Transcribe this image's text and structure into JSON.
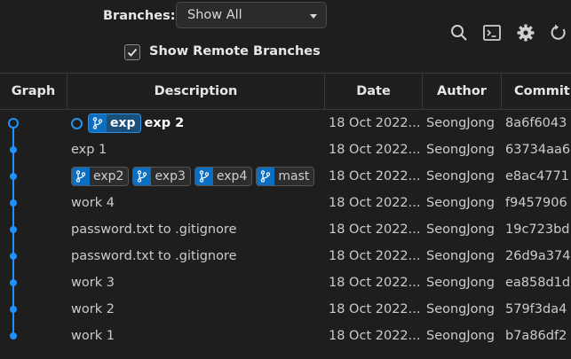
{
  "toolbar": {
    "branches_label": "Branches:",
    "branches_value": "Show All",
    "show_remote_label": "Show Remote Branches",
    "show_remote_checked": true,
    "icons": [
      "search-icon",
      "terminal-icon",
      "gear-icon",
      "refresh-icon"
    ]
  },
  "columns": {
    "graph": "Graph",
    "description": "Description",
    "date": "Date",
    "author": "Author",
    "commit": "Commit"
  },
  "colors": {
    "accent": "#0a6fc2",
    "graph": "#1e90ff"
  },
  "commits": [
    {
      "badges": [
        "exp"
      ],
      "description": "exp 2",
      "date": "18 Oct 2022...",
      "author": "SeongJong",
      "commit": "8a6f6043",
      "head": true
    },
    {
      "badges": [],
      "description": "exp 1",
      "date": "18 Oct 2022...",
      "author": "SeongJong",
      "commit": "63734aa6"
    },
    {
      "badges": [
        "exp2",
        "exp3",
        "exp4",
        "mast"
      ],
      "description": "",
      "date": "18 Oct 2022...",
      "author": "SeongJong",
      "commit": "e8ac4771"
    },
    {
      "badges": [],
      "description": "work 4",
      "date": "18 Oct 2022...",
      "author": "SeongJong",
      "commit": "f9457906"
    },
    {
      "badges": [],
      "description": "password.txt to .gitignore",
      "date": "18 Oct 2022...",
      "author": "SeongJong",
      "commit": "19c723bd"
    },
    {
      "badges": [],
      "description": "password.txt to .gitignore",
      "date": "18 Oct 2022...",
      "author": "SeongJong",
      "commit": "26d9a374"
    },
    {
      "badges": [],
      "description": "work 3",
      "date": "18 Oct 2022...",
      "author": "SeongJong",
      "commit": "ea858d1d"
    },
    {
      "badges": [],
      "description": "work 2",
      "date": "18 Oct 2022...",
      "author": "SeongJong",
      "commit": "579f3da4"
    },
    {
      "badges": [],
      "description": "work 1",
      "date": "18 Oct 2022...",
      "author": "SeongJong",
      "commit": "b7a86df2"
    }
  ]
}
